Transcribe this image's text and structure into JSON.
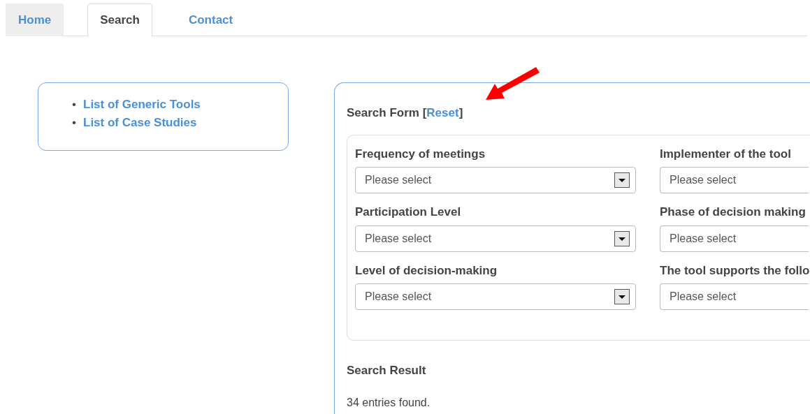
{
  "tabs": [
    {
      "label": "Home",
      "selected": false,
      "shaded": true
    },
    {
      "label": "Search",
      "selected": true,
      "shaded": false
    },
    {
      "label": "Contact",
      "selected": false,
      "shaded": false
    }
  ],
  "sidebar": {
    "items": [
      {
        "marker": "•",
        "label": "List of Generic Tools"
      },
      {
        "marker": "•",
        "label": "List of Case Studies"
      }
    ]
  },
  "search_form": {
    "title": "Search Form [",
    "reset_link": "Reset",
    "title_end": "]",
    "fields": [
      {
        "label": "Frequency of meetings",
        "value": "Please select"
      },
      {
        "label": "Implementer of the tool",
        "value": "Please select"
      },
      {
        "label": "Participation Level",
        "value": "Please select"
      },
      {
        "label": "Phase of decision making",
        "value": "Please select"
      },
      {
        "label": "Level of decision-making",
        "value": "Please select"
      },
      {
        "label": "The tool supports the follo",
        "value": "Please select"
      }
    ]
  },
  "search_result": {
    "title": "Search Result",
    "summary": "34 entries found."
  }
}
